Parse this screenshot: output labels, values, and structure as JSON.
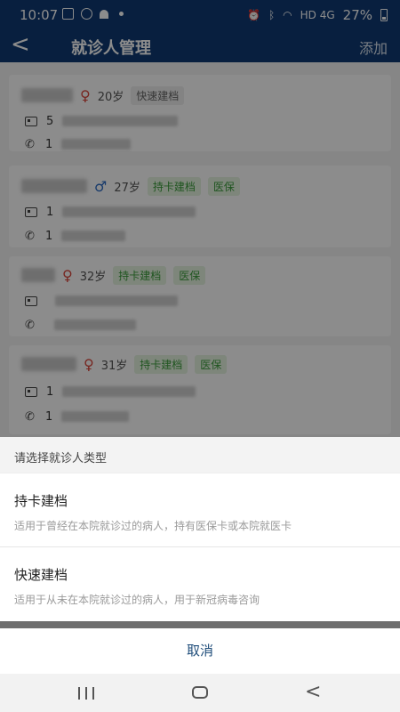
{
  "status_bar": {
    "time": "10:07",
    "battery": "27%",
    "network": "HD 4G"
  },
  "header": {
    "back_icon": "back-chevron-icon",
    "title": "就诊人管理",
    "add_label": "添加"
  },
  "patients": [
    {
      "gender": "female",
      "gender_symbol": "♀",
      "age": "20岁",
      "tags": [
        {
          "text": "快速建档",
          "style": "gray"
        }
      ],
      "id_prefix": "5",
      "phone_prefix": "1"
    },
    {
      "gender": "male",
      "gender_symbol": "♂",
      "age": "27岁",
      "tags": [
        {
          "text": "持卡建档",
          "style": "green"
        },
        {
          "text": "医保",
          "style": "green"
        }
      ],
      "id_prefix": "1",
      "phone_prefix": "1"
    },
    {
      "gender": "female",
      "gender_symbol": "♀",
      "age": "32岁",
      "tags": [
        {
          "text": "持卡建档",
          "style": "green"
        },
        {
          "text": "医保",
          "style": "green"
        }
      ],
      "id_prefix": "",
      "phone_prefix": ""
    },
    {
      "gender": "female",
      "gender_symbol": "♀",
      "age": "31岁",
      "tags": [
        {
          "text": "持卡建档",
          "style": "green"
        },
        {
          "text": "医保",
          "style": "green"
        }
      ],
      "id_prefix": "1",
      "phone_prefix": "1"
    }
  ],
  "sheet": {
    "title": "请选择就诊人类型",
    "options": [
      {
        "title": "持卡建档",
        "desc": "适用于曾经在本院就诊过的病人，持有医保卡或本院就医卡"
      },
      {
        "title": "快速建档",
        "desc": "适用于从未在本院就诊过的病人，用于新冠病毒咨询"
      }
    ],
    "cancel_label": "取消"
  },
  "icons": {
    "id_card": "id-card-icon",
    "phone": "phone-icon"
  },
  "colors": {
    "primary": "#0f3a73",
    "female": "#d9463b",
    "male": "#2d6cc4",
    "tag_green": "#3a9b3a"
  }
}
